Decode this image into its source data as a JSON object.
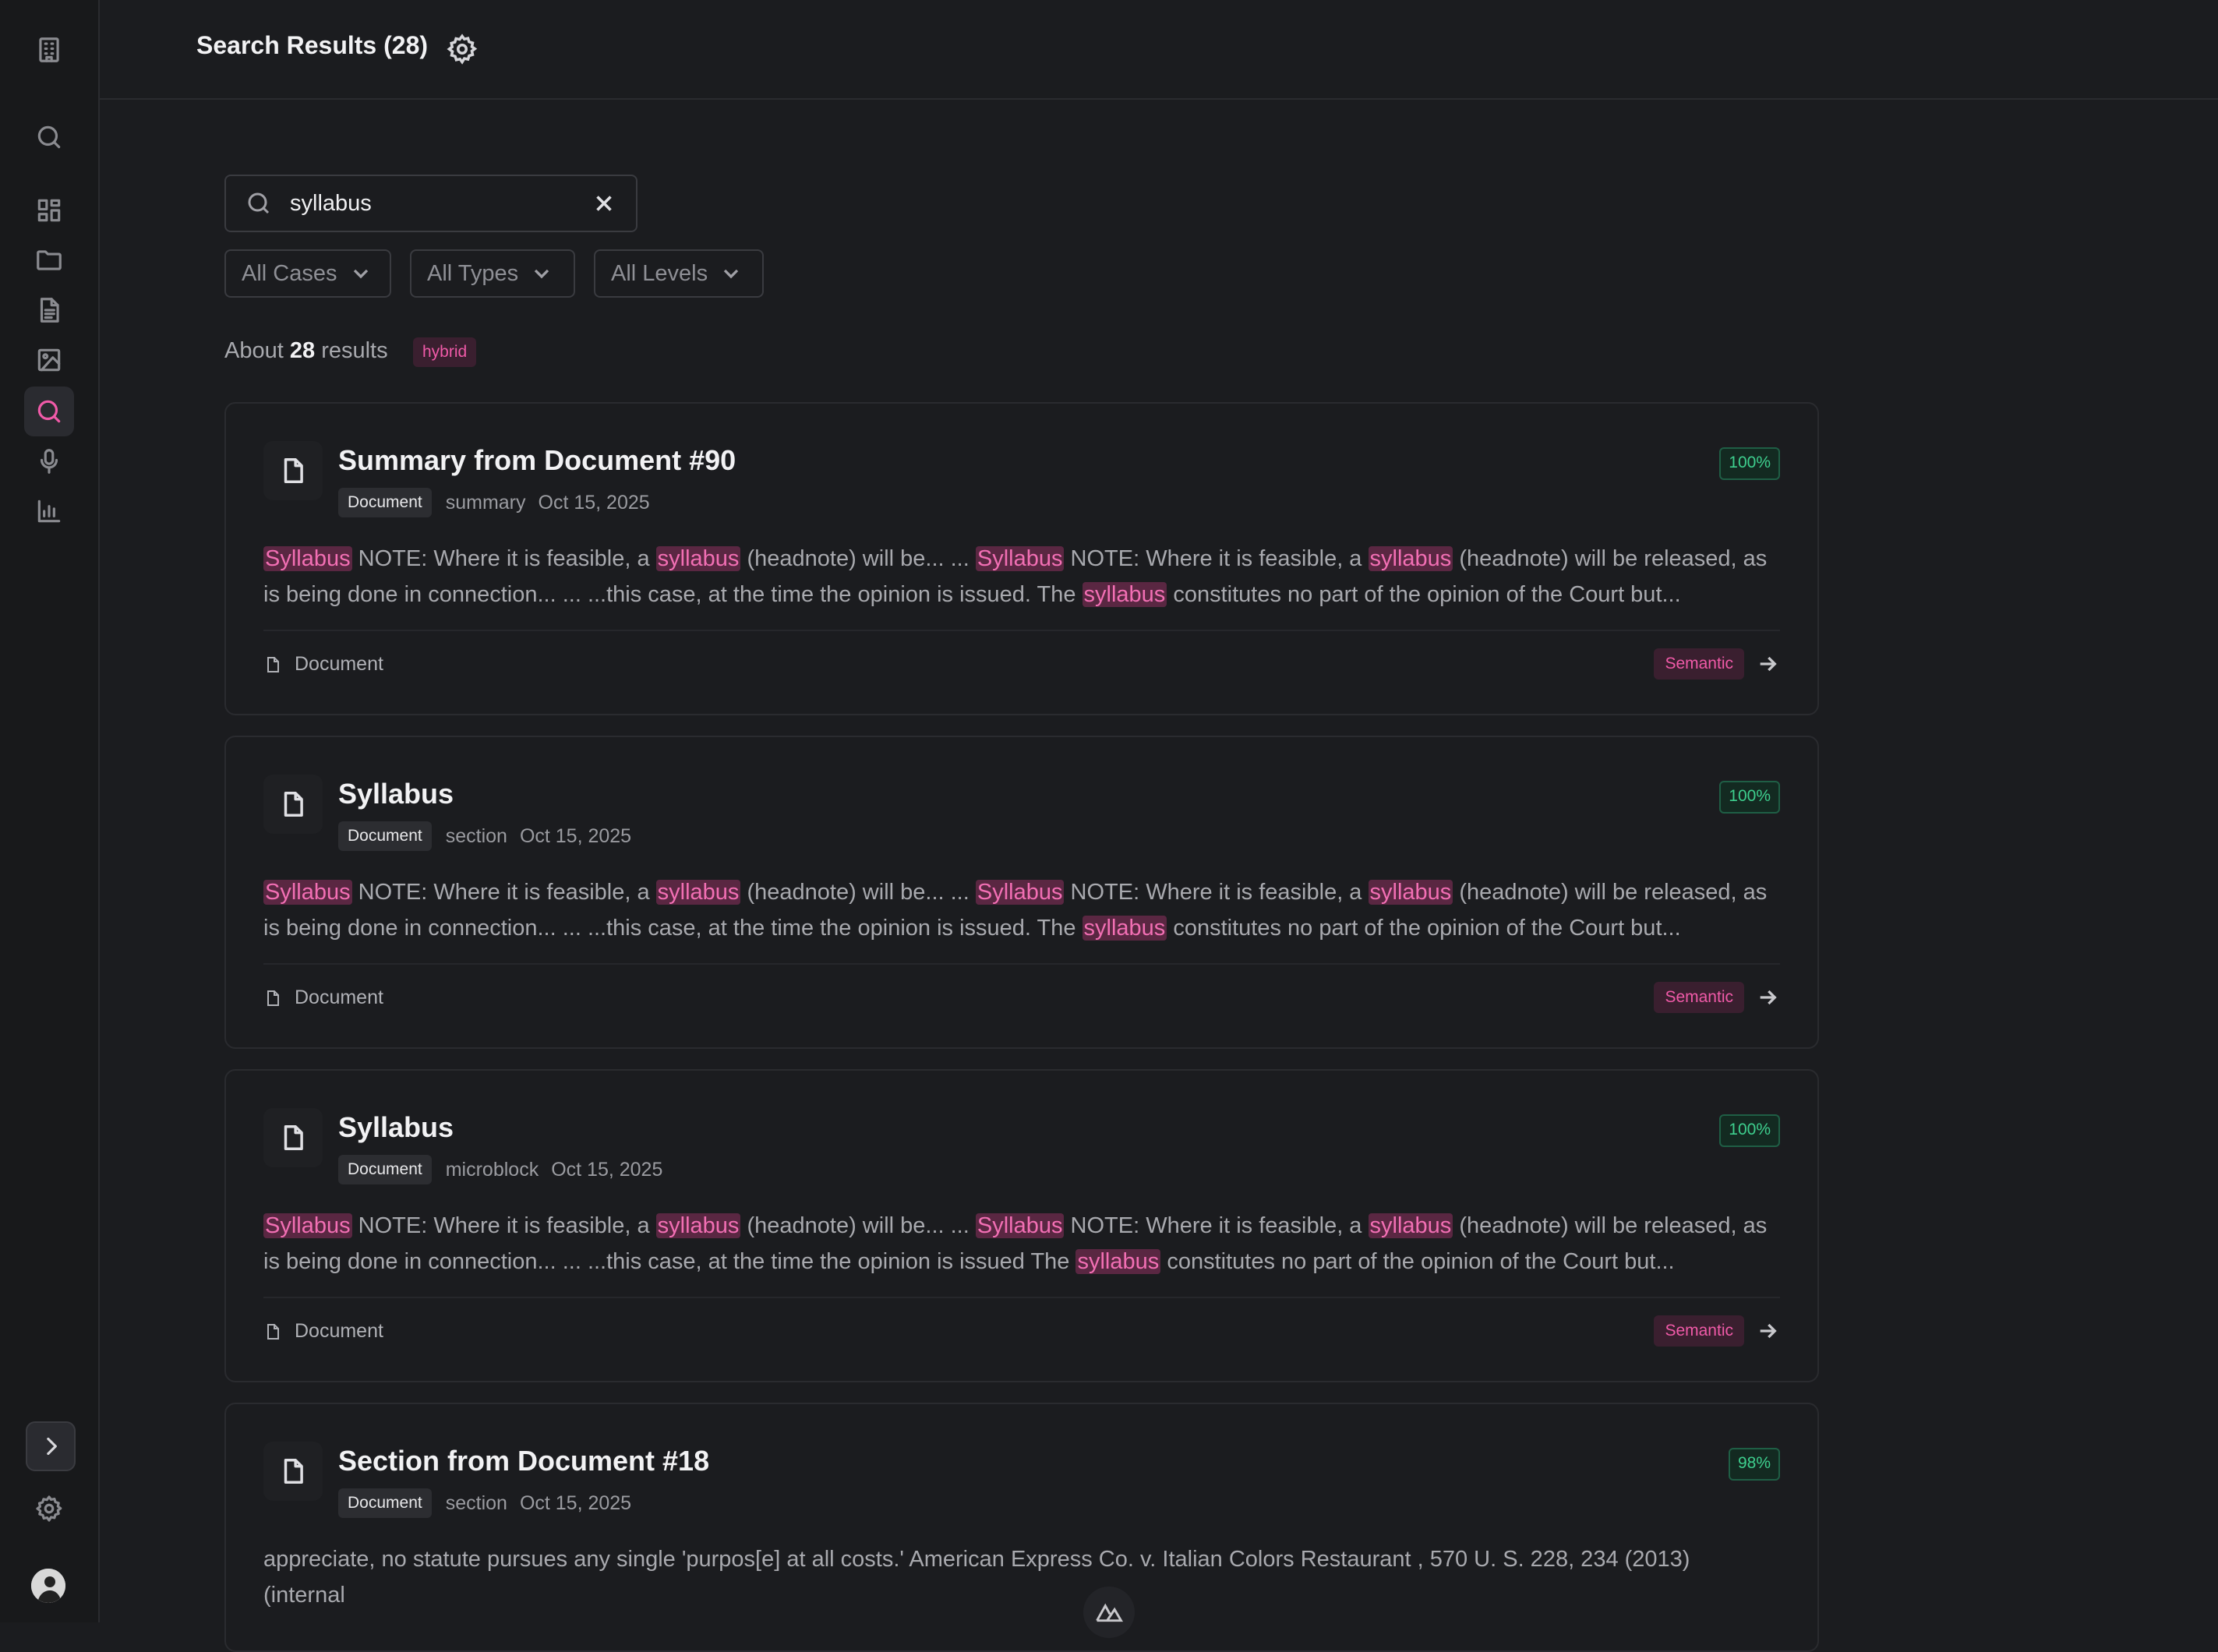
{
  "sidebar": {
    "items": [
      {
        "name": "building-icon"
      },
      {
        "name": "search-icon"
      },
      {
        "name": "dashboard-icon"
      },
      {
        "name": "folder-icon"
      },
      {
        "name": "document-icon"
      },
      {
        "name": "image-icon"
      },
      {
        "name": "search-icon",
        "active": true
      },
      {
        "name": "microphone-icon"
      },
      {
        "name": "bar-chart-icon"
      }
    ],
    "bottom": [
      {
        "name": "chevron-right-icon"
      },
      {
        "name": "gear-icon"
      },
      {
        "name": "avatar"
      }
    ]
  },
  "header": {
    "title": "Search Results (28)"
  },
  "search": {
    "value": "syllabus"
  },
  "filters": {
    "cases": "All Cases",
    "types": "All Types",
    "levels": "All Levels"
  },
  "summary": {
    "prefix": "About",
    "count": "28",
    "suffix": "results",
    "mode": "hybrid"
  },
  "results": [
    {
      "title": "Summary from Document #90",
      "tag": "Document",
      "kind": "summary",
      "date": "Oct 15, 2025",
      "score": "100%",
      "snippet": [
        {
          "hl": "Syllabus"
        },
        {
          "t": " NOTE: Where it is feasible, a "
        },
        {
          "hl": "syllabus"
        },
        {
          "t": " (headnote) will be... ... "
        },
        {
          "hl": "Syllabus"
        },
        {
          "t": " NOTE: Where it is feasible, a "
        },
        {
          "hl": "syllabus"
        },
        {
          "t": " (headnote) will be released, as is being done in connection... ... ...this case, at the time the opinion is issued. The "
        },
        {
          "hl": "syllabus"
        },
        {
          "t": " constitutes no part of the opinion of the Court but..."
        }
      ],
      "footer": "Document",
      "method": "Semantic"
    },
    {
      "title": "Syllabus",
      "tag": "Document",
      "kind": "section",
      "date": "Oct 15, 2025",
      "score": "100%",
      "snippet": [
        {
          "hl": "Syllabus"
        },
        {
          "t": " NOTE: Where it is feasible, a "
        },
        {
          "hl": "syllabus"
        },
        {
          "t": " (headnote) will be... ... "
        },
        {
          "hl": "Syllabus"
        },
        {
          "t": " NOTE: Where it is feasible, a "
        },
        {
          "hl": "syllabus"
        },
        {
          "t": " (headnote) will be released, as is being done in connection... ... ...this case, at the time the opinion is issued. The "
        },
        {
          "hl": "syllabus"
        },
        {
          "t": " constitutes no part of the opinion of the Court but..."
        }
      ],
      "footer": "Document",
      "method": "Semantic"
    },
    {
      "title": "Syllabus",
      "tag": "Document",
      "kind": "microblock",
      "date": "Oct 15, 2025",
      "score": "100%",
      "snippet": [
        {
          "hl": "Syllabus"
        },
        {
          "t": " NOTE: Where it is feasible, a "
        },
        {
          "hl": "syllabus"
        },
        {
          "t": " (headnote) will be... ... "
        },
        {
          "hl": "Syllabus"
        },
        {
          "t": " NOTE: Where it is feasible, a "
        },
        {
          "hl": "syllabus"
        },
        {
          "t": " (headnote) will be released, as is being done in connection... ... ...this case, at the time the opinion is issued The "
        },
        {
          "hl": "syllabus"
        },
        {
          "t": " constitutes no part of the opinion of the Court but..."
        }
      ],
      "footer": "Document",
      "method": "Semantic"
    },
    {
      "title": "Section from Document #18",
      "tag": "Document",
      "kind": "section",
      "date": "Oct 15, 2025",
      "score": "98%",
      "snippet": [
        {
          "t": "appreciate, no statute pursues any single 'purpos[e] at all costs.' American Express Co. v. Italian Colors Restaurant , 570 U. S. 228, 234 (2013) (internal"
        }
      ],
      "footer": "",
      "method": ""
    }
  ],
  "colors": {
    "accent": "#f05aa8",
    "score_green": "#3ecf8e",
    "background": "#1b1c1f"
  }
}
